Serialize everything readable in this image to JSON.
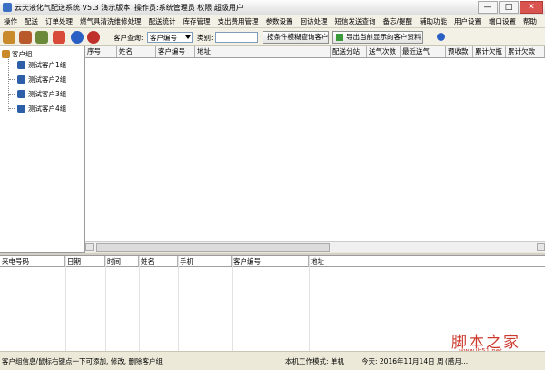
{
  "window": {
    "title": "云天液化气配送系统 V5.3 演示版本",
    "operator": "操作员:系统管理员 权限:超级用户",
    "minimize": "—",
    "maximize": "□",
    "close": "✕"
  },
  "menu": [
    "操作",
    "配送",
    "订单处理",
    "燃气具清洗维修处理",
    "配送统计",
    "库存管理",
    "支出费用管理",
    "参数设置",
    "回访处理",
    "短信发送查询",
    "备忘/提醒",
    "辅助功能",
    "用户设置",
    "端口设置",
    "帮助"
  ],
  "toolbar": {
    "icons": [
      {
        "name": "customer-group-icon",
        "color": "#c98a2c"
      },
      {
        "name": "users-icon",
        "color": "#b85a2c"
      },
      {
        "name": "settings-icon",
        "color": "#6a8a3a"
      },
      {
        "name": "calendar-icon",
        "color": "#d84a3a"
      },
      {
        "name": "help-icon",
        "color": "#2a5fc4"
      },
      {
        "name": "exit-icon",
        "color": "#c0302a"
      }
    ],
    "search_label": "客户查询:",
    "search_field_value": "客户编号",
    "category_label": "类别:",
    "category_value": "",
    "search_button": "按条件模糊查询客户",
    "export_button": "导出当前显示的客户资料"
  },
  "tree": {
    "root": "客户组",
    "children": [
      "测试客户1组",
      "测试客户2组",
      "测试客户3组",
      "测试客户4组"
    ]
  },
  "customer_grid": {
    "columns": [
      "序号",
      "姓名",
      "客户编号",
      "地址",
      "配送分站",
      "送气次数",
      "最近送气",
      "预收款",
      "累计欠瓶",
      "累计欠款"
    ]
  },
  "call_grid": {
    "columns": [
      "来电号码",
      "日期",
      "时间",
      "姓名",
      "手机",
      "客户编号",
      "地址"
    ]
  },
  "status": {
    "hint": "客户组信息/鼠标右键点一下可添加, 修改, 删除客户组",
    "mode": "本机工作模式: 单机",
    "date": "今天: 2016年11月14日 周",
    "extra": "(腊月..."
  },
  "watermark": {
    "text": "脚本之家",
    "url": "www.jb51.net"
  }
}
